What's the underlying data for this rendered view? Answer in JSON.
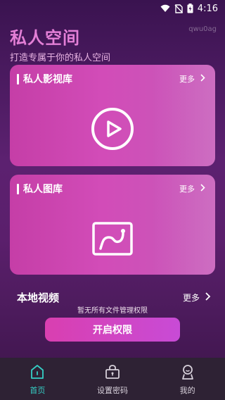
{
  "status": {
    "time": "4:16"
  },
  "header": {
    "title": "私人空间",
    "subtitle": "打造专属于你的私人空间",
    "watermark": "qwu0ag"
  },
  "cards": [
    {
      "title": "私人影视库",
      "more": "更多",
      "icon": "play-icon"
    },
    {
      "title": "私人图库",
      "more": "更多",
      "icon": "image-icon"
    }
  ],
  "local": {
    "title": "本地视频",
    "more": "更多",
    "empty_text": "暂无所有文件管理权限",
    "button": "开启权限"
  },
  "tabs": [
    {
      "label": "首页",
      "icon": "home-icon",
      "active": true
    },
    {
      "label": "设置密码",
      "icon": "lock-icon",
      "active": false
    },
    {
      "label": "我的",
      "icon": "profile-icon",
      "active": false
    }
  ],
  "colors": {
    "accent": "#35d0c6",
    "title": "#e37fd6",
    "card": "#c94ab1",
    "tabbar": "#2e2234"
  }
}
